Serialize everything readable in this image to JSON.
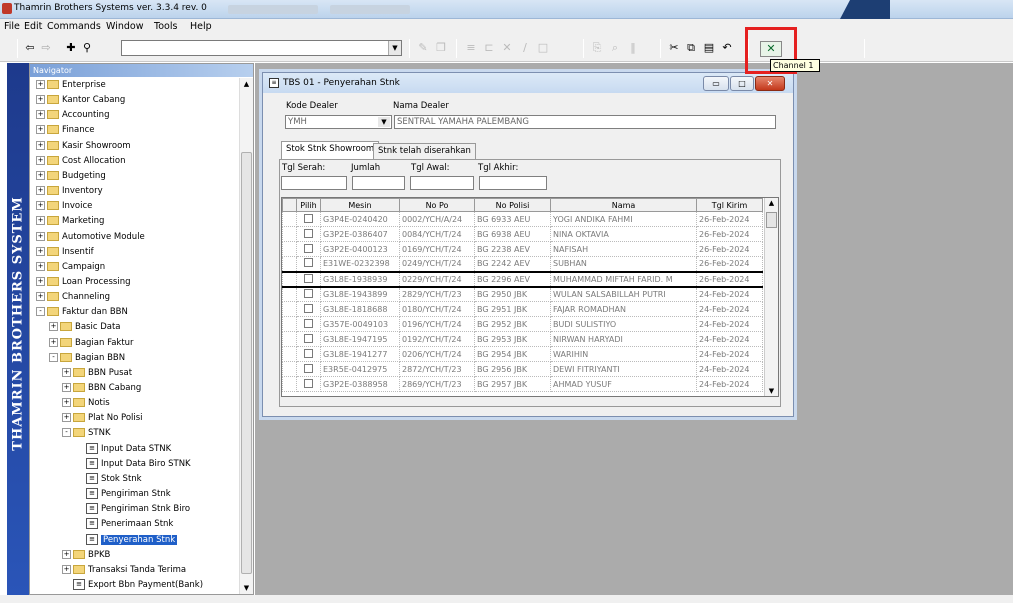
{
  "app": {
    "title": "Thamrin Brothers Systems ver. 3.3.4 rev. 0",
    "brand": "THAMRIN BROTHERS SYSTEM"
  },
  "menu": [
    "File",
    "Edit",
    "Commands",
    "Window",
    "Tools",
    "Help"
  ],
  "tooltip": "Channel 1",
  "navigator": {
    "header": "Navigator",
    "items": [
      {
        "label": "Enterprise",
        "level": 0,
        "type": "folder",
        "exp": "+"
      },
      {
        "label": "Kantor Cabang",
        "level": 0,
        "type": "folder",
        "exp": "+"
      },
      {
        "label": "Accounting",
        "level": 0,
        "type": "folder",
        "exp": "+"
      },
      {
        "label": "Finance",
        "level": 0,
        "type": "folder",
        "exp": "+"
      },
      {
        "label": "Kasir Showroom",
        "level": 0,
        "type": "folder",
        "exp": "+"
      },
      {
        "label": "Cost Allocation",
        "level": 0,
        "type": "folder",
        "exp": "+"
      },
      {
        "label": "Budgeting",
        "level": 0,
        "type": "folder",
        "exp": "+"
      },
      {
        "label": "Inventory",
        "level": 0,
        "type": "folder",
        "exp": "+"
      },
      {
        "label": "Invoice",
        "level": 0,
        "type": "folder",
        "exp": "+"
      },
      {
        "label": "Marketing",
        "level": 0,
        "type": "folder",
        "exp": "+"
      },
      {
        "label": "Automotive Module",
        "level": 0,
        "type": "folder",
        "exp": "+"
      },
      {
        "label": "Insentif",
        "level": 0,
        "type": "folder",
        "exp": "+"
      },
      {
        "label": "Campaign",
        "level": 0,
        "type": "folder",
        "exp": "+"
      },
      {
        "label": "Loan Processing",
        "level": 0,
        "type": "folder",
        "exp": "+"
      },
      {
        "label": "Channeling",
        "level": 0,
        "type": "folder",
        "exp": "+"
      },
      {
        "label": "Faktur dan BBN",
        "level": 0,
        "type": "folder",
        "exp": "-"
      },
      {
        "label": "Basic Data",
        "level": 1,
        "type": "folder",
        "exp": "+"
      },
      {
        "label": "Bagian Faktur",
        "level": 1,
        "type": "folder",
        "exp": "+"
      },
      {
        "label": "Bagian BBN",
        "level": 1,
        "type": "folder",
        "exp": "-"
      },
      {
        "label": "BBN Pusat",
        "level": 2,
        "type": "folder",
        "exp": "+"
      },
      {
        "label": "BBN Cabang",
        "level": 2,
        "type": "folder",
        "exp": "+"
      },
      {
        "label": "Notis",
        "level": 2,
        "type": "folder",
        "exp": "+"
      },
      {
        "label": "Plat No Polisi",
        "level": 2,
        "type": "folder",
        "exp": "+"
      },
      {
        "label": "STNK",
        "level": 2,
        "type": "folder",
        "exp": "-"
      },
      {
        "label": "Input Data STNK",
        "level": 3,
        "type": "form",
        "exp": ""
      },
      {
        "label": "Input Data Biro STNK",
        "level": 3,
        "type": "form",
        "exp": ""
      },
      {
        "label": "Stok Stnk",
        "level": 3,
        "type": "form",
        "exp": ""
      },
      {
        "label": "Pengiriman Stnk",
        "level": 3,
        "type": "form",
        "exp": ""
      },
      {
        "label": "Pengiriman Stnk Biro",
        "level": 3,
        "type": "form",
        "exp": ""
      },
      {
        "label": "Penerimaan Stnk",
        "level": 3,
        "type": "form",
        "exp": ""
      },
      {
        "label": "Penyerahan Stnk",
        "level": 3,
        "type": "form",
        "exp": "",
        "selected": true
      },
      {
        "label": "BPKB",
        "level": 2,
        "type": "folder",
        "exp": "+"
      },
      {
        "label": "Transaksi Tanda Terima",
        "level": 2,
        "type": "folder",
        "exp": "+"
      },
      {
        "label": "Export Bbn Payment(Bank)",
        "level": 2,
        "type": "form",
        "exp": ""
      }
    ]
  },
  "window": {
    "title": "TBS 01 - Penyerahan Stnk",
    "kode_dealer_label": "Kode Dealer",
    "nama_dealer_label": "Nama Dealer",
    "kode_dealer": "YMH",
    "nama_dealer": "SENTRAL YAMAHA PALEMBANG",
    "tabs": [
      "Stok Stnk Showroom",
      "Stnk telah diserahkan"
    ],
    "tgl_serah_label": "Tgl Serah:",
    "jumlah_label": "Jumlah",
    "tgl_awal_label": "Tgl Awal:",
    "tgl_akhir_label": "Tgl Akhir:",
    "columns": [
      "Pilih",
      "Mesin",
      "No Po",
      "No Polisi",
      "Nama",
      "Tgl Kirim"
    ],
    "rows": [
      [
        "G3P4E-0240420",
        "0002/YCH/A/24",
        "BG 6933 AEU",
        "YOGI ANDIKA FAHMI",
        "26-Feb-2024"
      ],
      [
        "G3P2E-0386407",
        "0084/YCH/T/24",
        "BG 6938 AEU",
        "NINA OKTAVIA",
        "26-Feb-2024"
      ],
      [
        "G3P2E-0400123",
        "0169/YCH/T/24",
        "BG 2238 AEV",
        "NAFISAH",
        "26-Feb-2024"
      ],
      [
        "E31WE-0232398",
        "0249/YCH/T/24",
        "BG 2242 AEV",
        "SUBHAN",
        "26-Feb-2024"
      ],
      [
        "G3L8E-1938939",
        "0229/YCH/T/24",
        "BG 2296 AEV",
        "MUHAMMAD MIFTAH FARID. M",
        "26-Feb-2024"
      ],
      [
        "G3L8E-1943899",
        "2829/YCH/T/23",
        "BG 2950 JBK",
        "WULAN SALSABILLAH PUTRI",
        "24-Feb-2024"
      ],
      [
        "G3L8E-1818688",
        "0180/YCH/T/24",
        "BG 2951 JBK",
        "FAJAR ROMADHAN",
        "24-Feb-2024"
      ],
      [
        "G357E-0049103",
        "0196/YCH/T/24",
        "BG 2952 JBK",
        "BUDI SULISTIYO",
        "24-Feb-2024"
      ],
      [
        "G3L8E-1947195",
        "0192/YCH/T/24",
        "BG 2953 JBK",
        "NIRWAN HARYADI",
        "24-Feb-2024"
      ],
      [
        "G3L8E-1941277",
        "0206/YCH/T/24",
        "BG 2954 JBK",
        "WARIHIN",
        "24-Feb-2024"
      ],
      [
        "E3R5E-0412975",
        "2872/YCH/T/23",
        "BG 2956 JBK",
        "DEWI FITRIYANTI",
        "24-Feb-2024"
      ],
      [
        "G3P2E-0388958",
        "2869/YCH/T/23",
        "BG 2957 JBK",
        "AHMAD YUSUF",
        "24-Feb-2024"
      ]
    ]
  }
}
